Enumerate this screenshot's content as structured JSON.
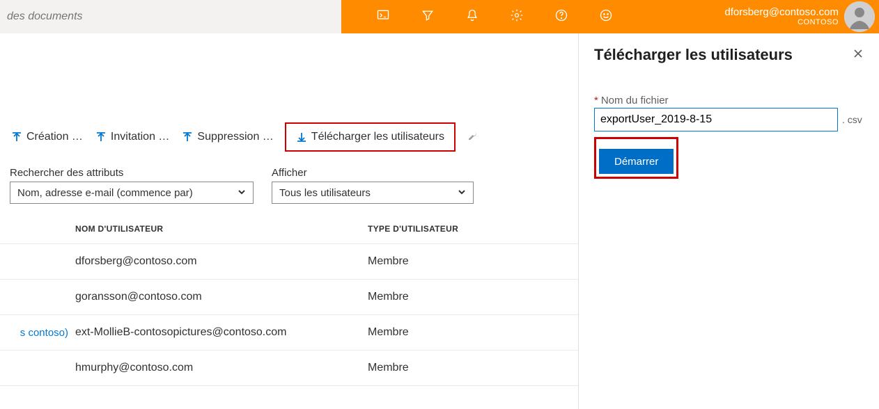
{
  "header": {
    "search_placeholder": "des documents",
    "account_email": "dforsberg@contoso.com",
    "account_tenant": "CONTOSO"
  },
  "toolbar": {
    "create": "Création …",
    "invite": "Invitation …",
    "delete": "Suppression …",
    "download": "Télécharger les utilisateurs"
  },
  "filters": {
    "search_label": "Rechercher des attributs",
    "search_selected": "Nom, adresse e-mail (commence par)",
    "show_label": "Afficher",
    "show_selected": "Tous les utilisateurs"
  },
  "table": {
    "col_user": "NOM D'UTILISATEUR",
    "col_type": "TYPE D'UTILISATEUR",
    "rows": [
      {
        "lead": "",
        "user": "dforsberg@contoso.com",
        "type": "Membre"
      },
      {
        "lead": "",
        "user": "goransson@contoso.com",
        "type": "Membre"
      },
      {
        "lead": "s contoso)",
        "user": "ext-MollieB-contosopictures@contoso.com",
        "type": "Membre"
      },
      {
        "lead": "",
        "user": "hmurphy@contoso.com",
        "type": "Membre"
      }
    ]
  },
  "panel": {
    "title": "Télécharger les utilisateurs",
    "field_label": "Nom du fichier",
    "field_value": "exportUser_2019-8-15",
    "extension": ". csv",
    "start_label": "Démarrer"
  }
}
